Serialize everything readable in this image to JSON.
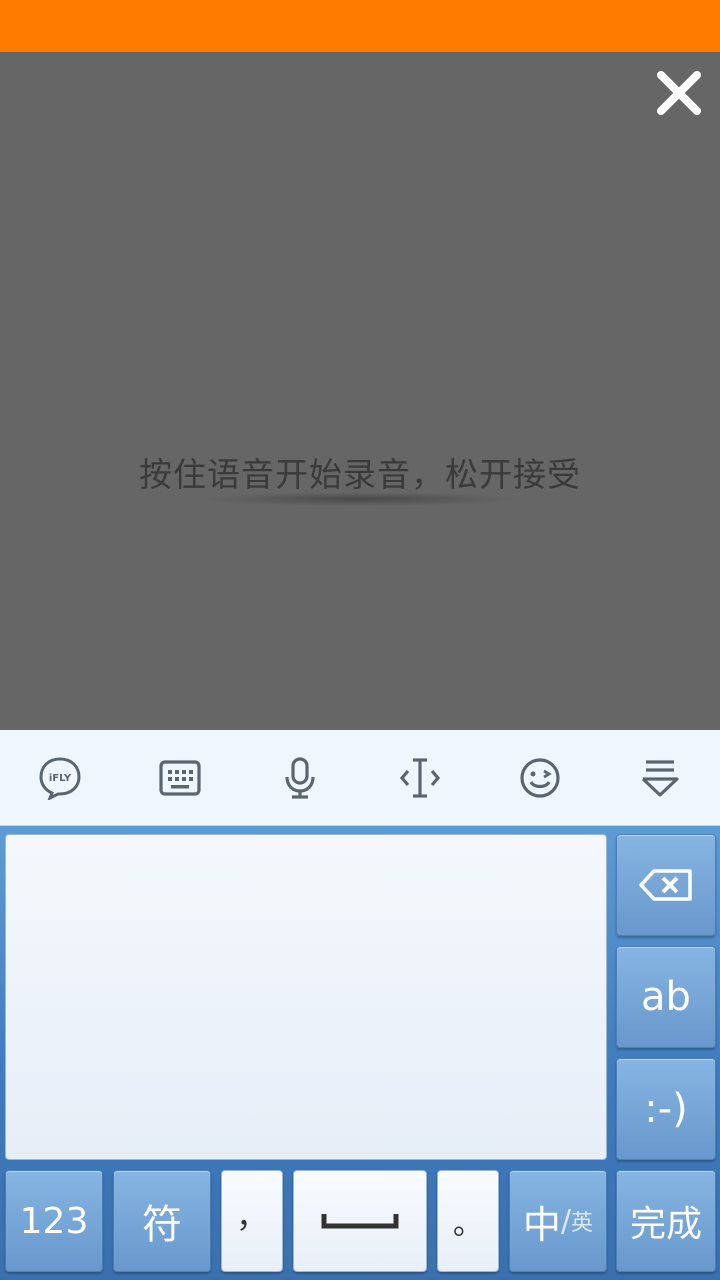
{
  "voice_overlay": {
    "hint": "按住语音开始录音，松开接受",
    "close_icon": "close-icon"
  },
  "toolbar": {
    "items": [
      {
        "name": "ifly-logo-button",
        "icon": "ifly-logo-icon",
        "label": "iFLY"
      },
      {
        "name": "keyboard-button",
        "icon": "keyboard-icon"
      },
      {
        "name": "microphone-button",
        "icon": "microphone-icon"
      },
      {
        "name": "cursor-button",
        "icon": "cursor-move-icon"
      },
      {
        "name": "emoji-button",
        "icon": "wink-face-icon"
      },
      {
        "name": "hide-keyboard-button",
        "icon": "hide-keyboard-icon"
      }
    ]
  },
  "keys": {
    "delete_icon": "backspace-icon",
    "ab": "ab",
    "smiley": ":-)",
    "num": "123",
    "symbol": "符",
    "comma": "，",
    "space_icon": "space-bar-icon",
    "period": "。",
    "lang_main": "中",
    "lang_slash": "/",
    "lang_sub": "英",
    "done": "完成"
  },
  "colors": {
    "status_bar": "#ff7b00",
    "overlay": "#666666",
    "keyboard_blue": "#4a86c4"
  }
}
